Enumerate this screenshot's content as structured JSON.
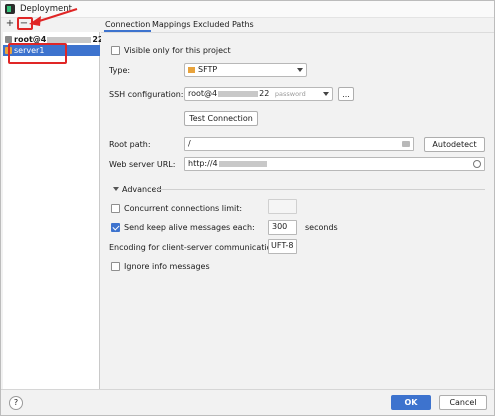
{
  "window": {
    "title": "Deployment"
  },
  "toolbar": {
    "add": "+",
    "remove": "−",
    "check": "✓"
  },
  "tree": {
    "root_prefix": "root@4",
    "root_suffix": "22",
    "items": [
      {
        "label": "server1",
        "selected": true
      }
    ]
  },
  "tabs": [
    {
      "label": "Connection",
      "active": true
    },
    {
      "label": "Mappings",
      "active": false
    },
    {
      "label": "Excluded Paths",
      "active": false
    }
  ],
  "connection": {
    "visible_only_label": "Visible only for this project",
    "visible_only_checked": false,
    "type_label": "Type:",
    "type_value": "SFTP",
    "ssh_label": "SSH configuration:",
    "ssh_value": "root@4",
    "ssh_value_suffix": "22",
    "ssh_hint": "password",
    "ssh_more": "...",
    "test_connection": "Test Connection",
    "root_path_label": "Root path:",
    "root_path_value": "/",
    "autodetect": "Autodetect",
    "web_url_label": "Web server URL:",
    "web_url_value": "http://4"
  },
  "advanced": {
    "title": "Advanced",
    "concurrent_label": "Concurrent connections limit:",
    "concurrent_checked": false,
    "concurrent_value": "",
    "keepalive_label": "Send keep alive messages each:",
    "keepalive_checked": true,
    "keepalive_value": "300",
    "keepalive_unit": "seconds",
    "encoding_label": "Encoding for client-server communication:",
    "encoding_value": "UFT-8",
    "ignore_label": "Ignore info messages",
    "ignore_checked": false
  },
  "footer": {
    "help": "?",
    "ok": "OK",
    "cancel": "Cancel"
  },
  "colors": {
    "accent": "#3d73ce",
    "annotation": "#e02626",
    "server_icon": "#e8a33c"
  }
}
